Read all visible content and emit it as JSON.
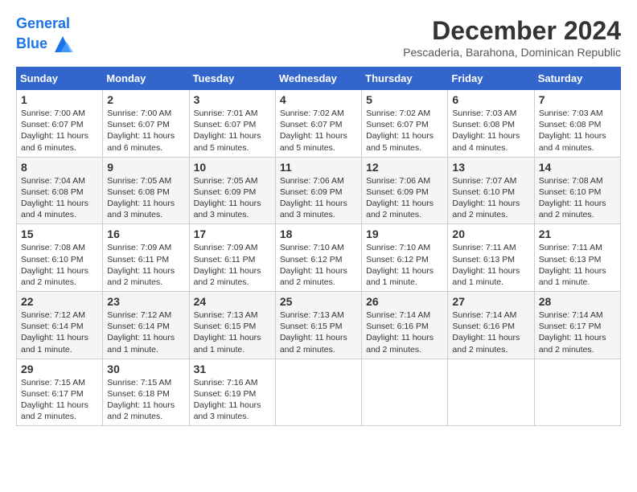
{
  "logo": {
    "line1": "General",
    "line2": "Blue"
  },
  "title": "December 2024",
  "location": "Pescaderia, Barahona, Dominican Republic",
  "days_of_week": [
    "Sunday",
    "Monday",
    "Tuesday",
    "Wednesday",
    "Thursday",
    "Friday",
    "Saturday"
  ],
  "weeks": [
    [
      {
        "day": "1",
        "info": "Sunrise: 7:00 AM\nSunset: 6:07 PM\nDaylight: 11 hours and 6 minutes."
      },
      {
        "day": "2",
        "info": "Sunrise: 7:00 AM\nSunset: 6:07 PM\nDaylight: 11 hours and 6 minutes."
      },
      {
        "day": "3",
        "info": "Sunrise: 7:01 AM\nSunset: 6:07 PM\nDaylight: 11 hours and 5 minutes."
      },
      {
        "day": "4",
        "info": "Sunrise: 7:02 AM\nSunset: 6:07 PM\nDaylight: 11 hours and 5 minutes."
      },
      {
        "day": "5",
        "info": "Sunrise: 7:02 AM\nSunset: 6:07 PM\nDaylight: 11 hours and 5 minutes."
      },
      {
        "day": "6",
        "info": "Sunrise: 7:03 AM\nSunset: 6:08 PM\nDaylight: 11 hours and 4 minutes."
      },
      {
        "day": "7",
        "info": "Sunrise: 7:03 AM\nSunset: 6:08 PM\nDaylight: 11 hours and 4 minutes."
      }
    ],
    [
      {
        "day": "8",
        "info": "Sunrise: 7:04 AM\nSunset: 6:08 PM\nDaylight: 11 hours and 4 minutes."
      },
      {
        "day": "9",
        "info": "Sunrise: 7:05 AM\nSunset: 6:08 PM\nDaylight: 11 hours and 3 minutes."
      },
      {
        "day": "10",
        "info": "Sunrise: 7:05 AM\nSunset: 6:09 PM\nDaylight: 11 hours and 3 minutes."
      },
      {
        "day": "11",
        "info": "Sunrise: 7:06 AM\nSunset: 6:09 PM\nDaylight: 11 hours and 3 minutes."
      },
      {
        "day": "12",
        "info": "Sunrise: 7:06 AM\nSunset: 6:09 PM\nDaylight: 11 hours and 2 minutes."
      },
      {
        "day": "13",
        "info": "Sunrise: 7:07 AM\nSunset: 6:10 PM\nDaylight: 11 hours and 2 minutes."
      },
      {
        "day": "14",
        "info": "Sunrise: 7:08 AM\nSunset: 6:10 PM\nDaylight: 11 hours and 2 minutes."
      }
    ],
    [
      {
        "day": "15",
        "info": "Sunrise: 7:08 AM\nSunset: 6:10 PM\nDaylight: 11 hours and 2 minutes."
      },
      {
        "day": "16",
        "info": "Sunrise: 7:09 AM\nSunset: 6:11 PM\nDaylight: 11 hours and 2 minutes."
      },
      {
        "day": "17",
        "info": "Sunrise: 7:09 AM\nSunset: 6:11 PM\nDaylight: 11 hours and 2 minutes."
      },
      {
        "day": "18",
        "info": "Sunrise: 7:10 AM\nSunset: 6:12 PM\nDaylight: 11 hours and 2 minutes."
      },
      {
        "day": "19",
        "info": "Sunrise: 7:10 AM\nSunset: 6:12 PM\nDaylight: 11 hours and 1 minute."
      },
      {
        "day": "20",
        "info": "Sunrise: 7:11 AM\nSunset: 6:13 PM\nDaylight: 11 hours and 1 minute."
      },
      {
        "day": "21",
        "info": "Sunrise: 7:11 AM\nSunset: 6:13 PM\nDaylight: 11 hours and 1 minute."
      }
    ],
    [
      {
        "day": "22",
        "info": "Sunrise: 7:12 AM\nSunset: 6:14 PM\nDaylight: 11 hours and 1 minute."
      },
      {
        "day": "23",
        "info": "Sunrise: 7:12 AM\nSunset: 6:14 PM\nDaylight: 11 hours and 1 minute."
      },
      {
        "day": "24",
        "info": "Sunrise: 7:13 AM\nSunset: 6:15 PM\nDaylight: 11 hours and 1 minute."
      },
      {
        "day": "25",
        "info": "Sunrise: 7:13 AM\nSunset: 6:15 PM\nDaylight: 11 hours and 2 minutes."
      },
      {
        "day": "26",
        "info": "Sunrise: 7:14 AM\nSunset: 6:16 PM\nDaylight: 11 hours and 2 minutes."
      },
      {
        "day": "27",
        "info": "Sunrise: 7:14 AM\nSunset: 6:16 PM\nDaylight: 11 hours and 2 minutes."
      },
      {
        "day": "28",
        "info": "Sunrise: 7:14 AM\nSunset: 6:17 PM\nDaylight: 11 hours and 2 minutes."
      }
    ],
    [
      {
        "day": "29",
        "info": "Sunrise: 7:15 AM\nSunset: 6:17 PM\nDaylight: 11 hours and 2 minutes."
      },
      {
        "day": "30",
        "info": "Sunrise: 7:15 AM\nSunset: 6:18 PM\nDaylight: 11 hours and 2 minutes."
      },
      {
        "day": "31",
        "info": "Sunrise: 7:16 AM\nSunset: 6:19 PM\nDaylight: 11 hours and 3 minutes."
      },
      {
        "day": "",
        "info": ""
      },
      {
        "day": "",
        "info": ""
      },
      {
        "day": "",
        "info": ""
      },
      {
        "day": "",
        "info": ""
      }
    ]
  ]
}
